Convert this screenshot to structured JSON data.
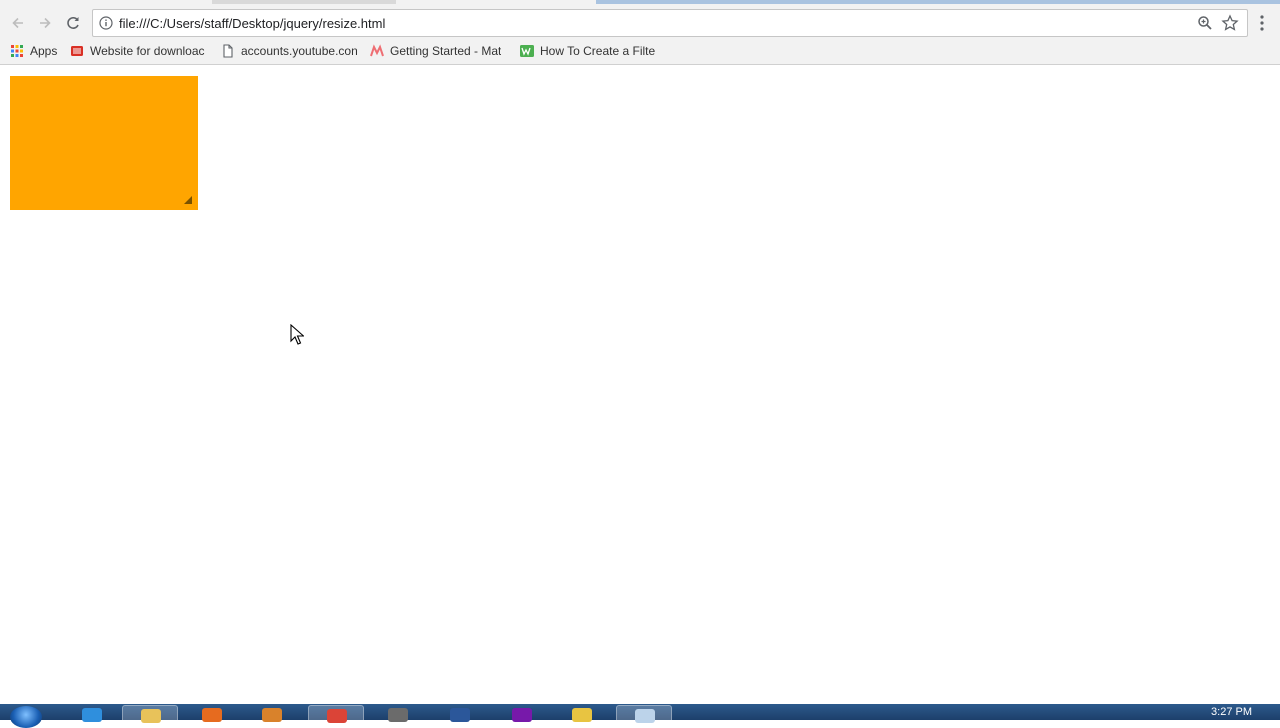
{
  "browser": {
    "address_bar": {
      "url": "file:///C:/Users/staff/Desktop/jquery/resize.html"
    },
    "bookmarks": [
      {
        "label": "Apps",
        "icon": "apps-grid-icon"
      },
      {
        "label": "Website for downloac",
        "icon": "video-site-icon"
      },
      {
        "label": "accounts.youtube.con",
        "icon": "page-icon"
      },
      {
        "label": "Getting Started - Mat",
        "icon": "materialize-icon"
      },
      {
        "label": "How To Create a Filte",
        "icon": "w3schools-icon"
      }
    ]
  },
  "page": {
    "resizable_box": {
      "color": "#ffa500"
    }
  },
  "taskbar": {
    "clock": "3:27 PM",
    "tray_text": "ⓘ"
  },
  "colors": {
    "accent": "#ffa500",
    "chrome_bg": "#f2f2f2",
    "taskbar": "#1d3f6b"
  }
}
